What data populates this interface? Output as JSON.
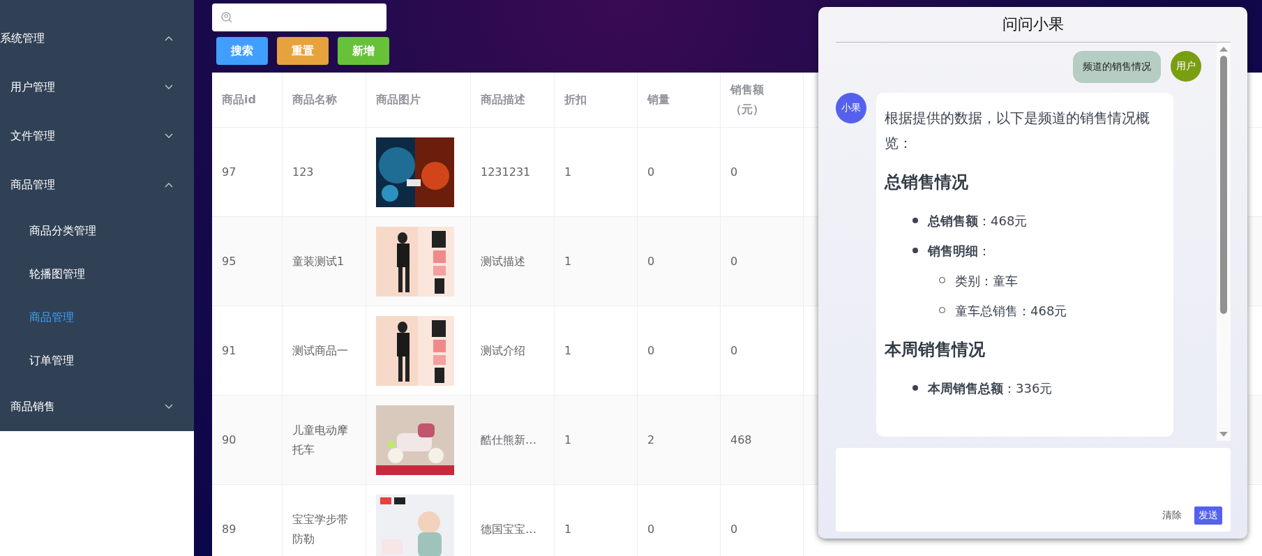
{
  "sidebar": {
    "items": [
      {
        "label": "系统管理",
        "expanded": true,
        "children": [
          {
            "label": "用户管理",
            "expanded": false
          },
          {
            "label": "文件管理",
            "expanded": false
          },
          {
            "label": "商品管理",
            "expanded": true,
            "children": [
              {
                "label": "商品分类管理",
                "selected": false
              },
              {
                "label": "轮播图管理",
                "selected": false
              },
              {
                "label": "商品管理",
                "selected": true
              },
              {
                "label": "订单管理",
                "selected": false
              }
            ]
          },
          {
            "label": "商品销售",
            "expanded": false
          }
        ]
      }
    ]
  },
  "toolbar": {
    "buttons": [
      {
        "label": "搜索",
        "kind": "primary"
      },
      {
        "label": "重置",
        "kind": "warning"
      },
      {
        "label": "新增",
        "kind": "success"
      }
    ]
  },
  "table": {
    "columns": [
      "商品id",
      "商品名称",
      "商品图片",
      "商品描述",
      "折扣",
      "销量",
      "销售额（元）"
    ],
    "rows": [
      {
        "id": "97",
        "name": "123",
        "description": "1231231",
        "discount": "1",
        "sales": "0",
        "amount": "0"
      },
      {
        "id": "95",
        "name": "童装测试1",
        "description": "测试描述",
        "discount": "1",
        "sales": "0",
        "amount": "0"
      },
      {
        "id": "91",
        "name": "测试商品一",
        "description": "测试介绍",
        "discount": "1",
        "sales": "0",
        "amount": "0"
      },
      {
        "id": "90",
        "name": "儿童电动摩托车",
        "description": "酷仕熊新…",
        "discount": "1",
        "sales": "2",
        "amount": "468"
      },
      {
        "id": "89",
        "name": "宝宝学步带防勒",
        "description": "德国宝宝…",
        "discount": "1",
        "sales": "0",
        "amount": "0"
      }
    ]
  },
  "chat": {
    "title": "问问小果",
    "messages": [
      {
        "kind": "user",
        "avatar": "用户",
        "text": "频道的销售情况"
      },
      {
        "kind": "assistant",
        "avatar": "小果",
        "blocks": [
          {
            "kind": "paragraph",
            "text": "根据提供的数据，以下是频道的销售情况概览："
          },
          {
            "kind": "heading",
            "text": "总销售情况"
          },
          {
            "kind": "list",
            "items": [
              {
                "text": "**总销售额**：468元"
              },
              {
                "text": "**销售明细**：",
                "children": [
                  {
                    "text": "类别：童车"
                  },
                  {
                    "text": "童车总销售：468元"
                  }
                ]
              }
            ]
          },
          {
            "kind": "heading",
            "text": "本周销售情况"
          },
          {
            "kind": "list",
            "items": [
              {
                "text": "**本周销售总额**：336元"
              }
            ]
          }
        ]
      }
    ],
    "input": {
      "buttons": [
        {
          "label": "清除",
          "kind": "plain"
        },
        {
          "label": "发送",
          "kind": "primary"
        }
      ]
    }
  }
}
